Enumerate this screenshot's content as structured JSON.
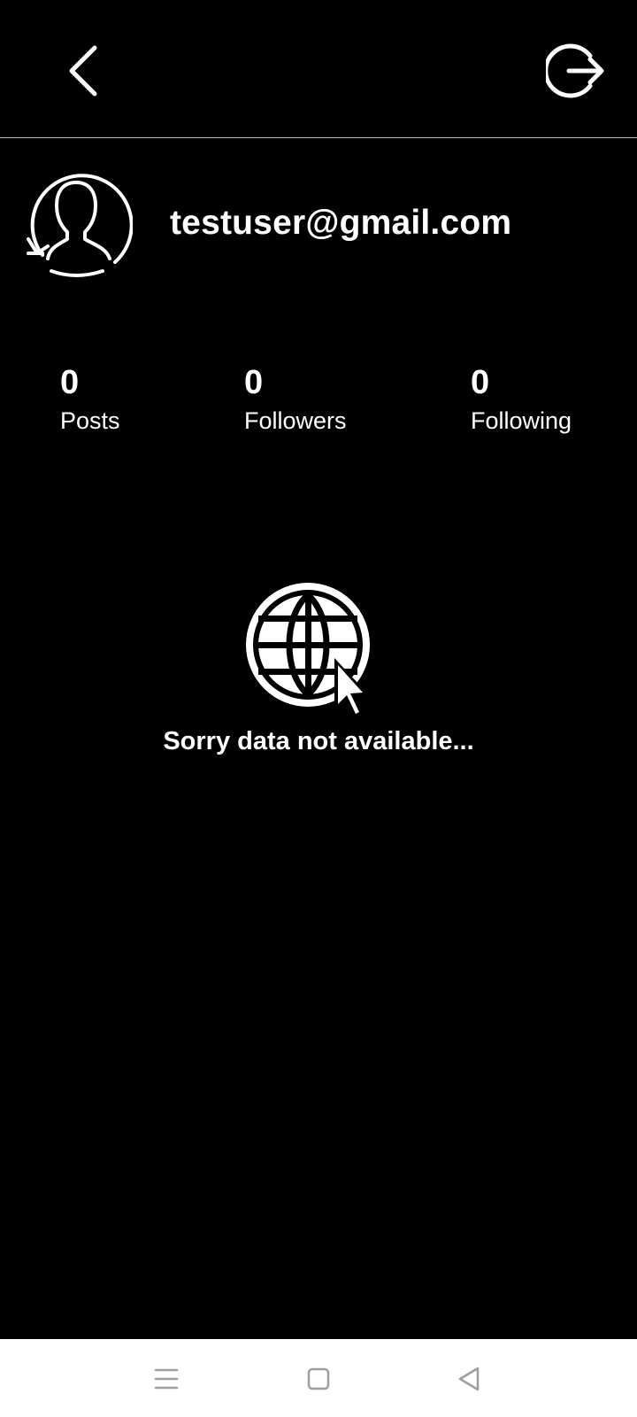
{
  "header": {
    "back_icon": "chevron-left-icon",
    "logout_icon": "logout-icon"
  },
  "profile": {
    "avatar_icon": "user-avatar-icon",
    "email": "testuser@gmail.com"
  },
  "stats": [
    {
      "count": "0",
      "label": "Posts"
    },
    {
      "count": "0",
      "label": "Followers"
    },
    {
      "count": "0",
      "label": "Following"
    }
  ],
  "empty_state": {
    "icon": "globe-cursor-icon",
    "message": "Sorry data not available..."
  },
  "system_nav": {
    "menu_icon": "menu-icon",
    "home_icon": "home-square-icon",
    "back_icon": "back-triangle-icon"
  },
  "colors": {
    "background": "#000000",
    "foreground": "#ffffff",
    "nav_background": "#ffffff",
    "nav_icon": "#9e9e9e"
  }
}
